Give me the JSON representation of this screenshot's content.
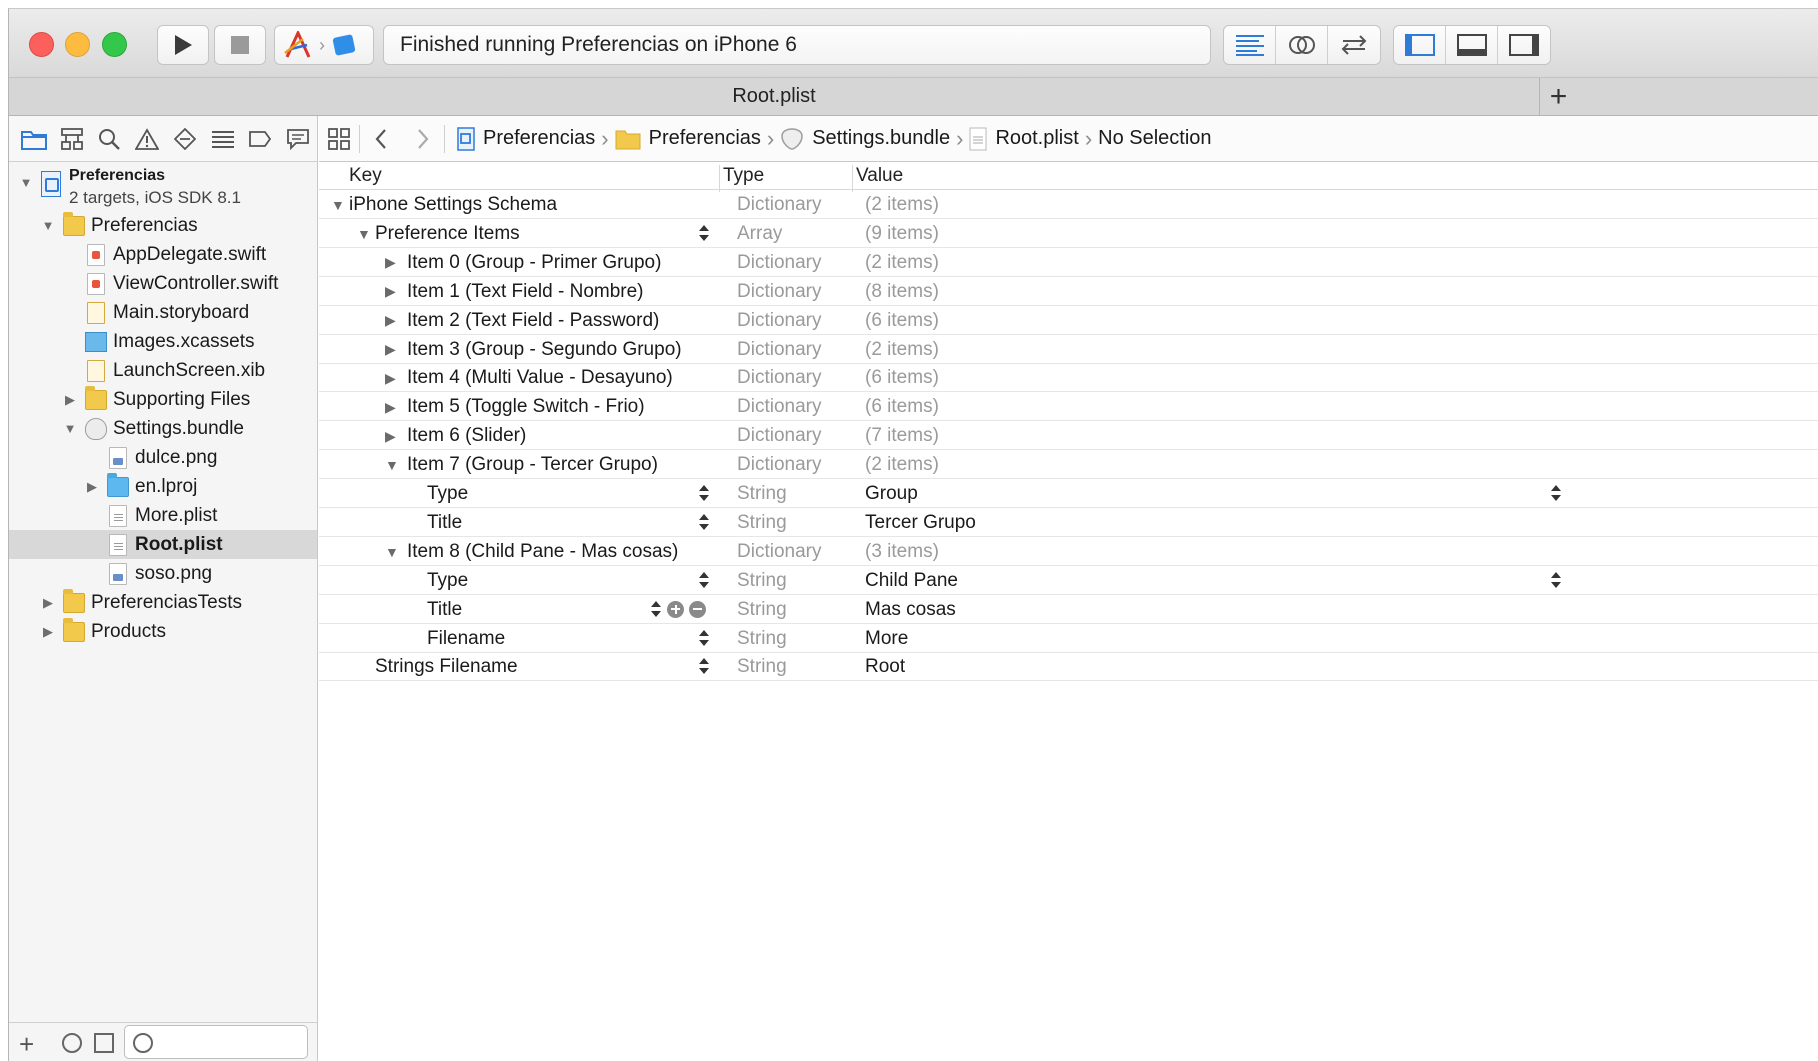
{
  "toolbar": {
    "activity_text": "Finished running Preferencias on iPhone 6",
    "icons": [
      "play-icon",
      "stop-icon",
      "app-scheme-icon",
      "device-icon",
      "standard-editor-icon",
      "assistant-editor-icon",
      "version-editor-icon",
      "navigator-toggle-icon",
      "debug-area-toggle-icon",
      "utilities-toggle-icon"
    ]
  },
  "tab": {
    "title": "Root.plist",
    "add_label": "+"
  },
  "navigator": {
    "project": {
      "name": "Preferencias",
      "subtitle": "2 targets, iOS SDK 8.1"
    },
    "items": [
      {
        "label": "Preferencias",
        "kind": "folder",
        "level": 1,
        "expanded": true
      },
      {
        "label": "AppDelegate.swift",
        "kind": "swift",
        "level": 2
      },
      {
        "label": "ViewController.swift",
        "kind": "swift",
        "level": 2
      },
      {
        "label": "Main.storyboard",
        "kind": "storyboard",
        "level": 2
      },
      {
        "label": "Images.xcassets",
        "kind": "xcassets",
        "level": 2
      },
      {
        "label": "LaunchScreen.xib",
        "kind": "storyboard",
        "level": 2
      },
      {
        "label": "Supporting Files",
        "kind": "folder",
        "level": 2,
        "expanded": false
      },
      {
        "label": "Settings.bundle",
        "kind": "bundle",
        "level": 2,
        "expanded": true
      },
      {
        "label": "dulce.png",
        "kind": "png",
        "level": 3
      },
      {
        "label": "en.lproj",
        "kind": "blue-folder",
        "level": 3,
        "expanded": false
      },
      {
        "label": "More.plist",
        "kind": "plist",
        "level": 3
      },
      {
        "label": "Root.plist",
        "kind": "plist",
        "level": 3,
        "selected": true
      },
      {
        "label": "soso.png",
        "kind": "png",
        "level": 3
      },
      {
        "label": "PreferenciasTests",
        "kind": "folder",
        "level": 1,
        "expanded": false
      },
      {
        "label": "Products",
        "kind": "folder",
        "level": 1,
        "expanded": false
      }
    ]
  },
  "jumpbar": {
    "crumbs": [
      "Preferencias",
      "Preferencias",
      "Settings.bundle",
      "Root.plist",
      "No Selection"
    ]
  },
  "plist": {
    "headers": {
      "key": "Key",
      "type": "Type",
      "value": "Value"
    },
    "rows": [
      {
        "key": "iPhone Settings Schema",
        "type": "Dictionary",
        "value": "(2 items)",
        "level": 0,
        "disclosure": "open"
      },
      {
        "key": "Preference Items",
        "type": "Array",
        "value": "(9 items)",
        "level": 1,
        "disclosure": "open",
        "stepper": true
      },
      {
        "key": "Item 0 (Group - Primer Grupo)",
        "type": "Dictionary",
        "value": "(2 items)",
        "level": 2,
        "disclosure": "closed"
      },
      {
        "key": "Item 1 (Text Field - Nombre)",
        "type": "Dictionary",
        "value": "(8 items)",
        "level": 2,
        "disclosure": "closed"
      },
      {
        "key": "Item 2 (Text Field - Password)",
        "type": "Dictionary",
        "value": "(6 items)",
        "level": 2,
        "disclosure": "closed"
      },
      {
        "key": "Item 3 (Group - Segundo Grupo)",
        "type": "Dictionary",
        "value": "(2 items)",
        "level": 2,
        "disclosure": "closed"
      },
      {
        "key": "Item 4 (Multi Value - Desayuno)",
        "type": "Dictionary",
        "value": "(6 items)",
        "level": 2,
        "disclosure": "closed"
      },
      {
        "key": "Item 5 (Toggle Switch - Frio)",
        "type": "Dictionary",
        "value": "(6 items)",
        "level": 2,
        "disclosure": "closed"
      },
      {
        "key": "Item 6 (Slider)",
        "type": "Dictionary",
        "value": "(7 items)",
        "level": 2,
        "disclosure": "closed"
      },
      {
        "key": "Item 7 (Group - Tercer Grupo)",
        "type": "Dictionary",
        "value": "(2 items)",
        "level": 2,
        "disclosure": "open"
      },
      {
        "key": "Type",
        "type": "String",
        "value": "Group",
        "level": 3,
        "stepper": true,
        "value_stepper": true
      },
      {
        "key": "Title",
        "type": "String",
        "value": "Tercer Grupo",
        "level": 3,
        "stepper": true
      },
      {
        "key": "Item 8 (Child Pane - Mas cosas)",
        "type": "Dictionary",
        "value": "(3 items)",
        "level": 2,
        "disclosure": "open"
      },
      {
        "key": "Type",
        "type": "String",
        "value": "Child Pane",
        "level": 3,
        "stepper": true,
        "value_stepper": true
      },
      {
        "key": "Title",
        "type": "String",
        "value": "Mas cosas",
        "level": 3,
        "stepper": true,
        "add_remove": true
      },
      {
        "key": "Filename",
        "type": "String",
        "value": "More",
        "level": 3,
        "stepper": true
      },
      {
        "key": "Strings Filename",
        "type": "String",
        "value": "Root",
        "level": 1,
        "stepper": true
      }
    ]
  },
  "colors": {
    "accent": "#2f7cd8",
    "selection": "#d8d8d8",
    "muted_text": "#9a9a9a"
  }
}
